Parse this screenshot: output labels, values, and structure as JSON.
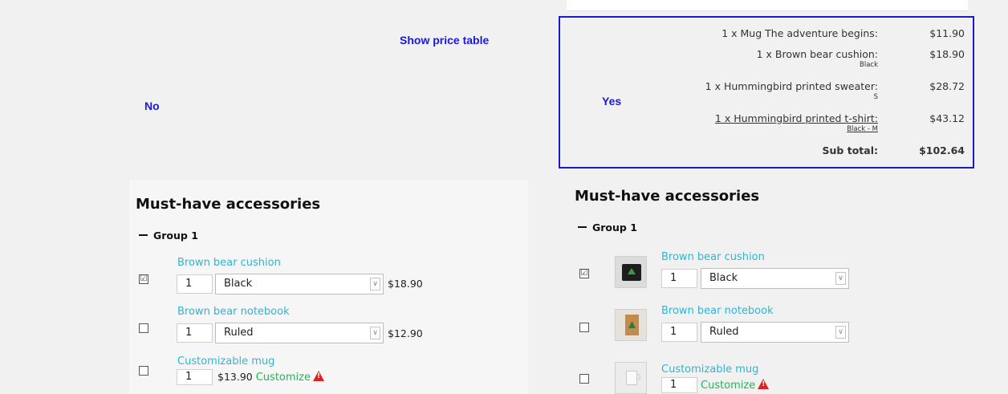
{
  "colors": {
    "accent_blue": "#1a1acd",
    "link": "#2fb5d2",
    "customize": "#24b35a",
    "warning": "#e02020"
  },
  "top": {
    "show_price_table": "Show price table",
    "no_label": "No",
    "yes_label": "Yes"
  },
  "price_table": {
    "rows": [
      {
        "name": "1 x Mug The adventure begins:",
        "sub": "",
        "price": "$11.90"
      },
      {
        "name": "1 x Brown bear cushion:",
        "sub": "Black",
        "price": "$18.90"
      },
      {
        "name": "1 x Hummingbird printed sweater:",
        "sub": "S",
        "price": "$28.72"
      },
      {
        "name": "1 x Hummingbird printed t-shirt:",
        "sub": "Black - M",
        "price": "$43.12"
      }
    ],
    "subtotal_label": "Sub total:",
    "subtotal_value": "$102.64"
  },
  "left": {
    "title": "Must-have accessories",
    "group": "Group 1",
    "items": [
      {
        "name": "Brown bear cushion",
        "checked": true,
        "qty": "1",
        "option": "Black",
        "price": "$18.90"
      },
      {
        "name": "Brown bear notebook",
        "checked": false,
        "qty": "1",
        "option": "Ruled",
        "price": "$12.90"
      },
      {
        "name": "Customizable mug",
        "checked": false,
        "qty": "1",
        "price": "$13.90",
        "customize": "Customize"
      }
    ]
  },
  "right": {
    "title": "Must-have accessories",
    "group": "Group 1",
    "items": [
      {
        "name": "Brown bear cushion",
        "checked": true,
        "qty": "1",
        "option": "Black",
        "thumb": "cushion-thumbnail"
      },
      {
        "name": "Brown bear notebook",
        "checked": false,
        "qty": "1",
        "option": "Ruled",
        "thumb": "notebook-thumbnail"
      },
      {
        "name": "Customizable mug",
        "checked": false,
        "qty": "1",
        "customize": "Customize",
        "thumb": "mug-thumbnail"
      }
    ]
  },
  "checkmark": "☑"
}
